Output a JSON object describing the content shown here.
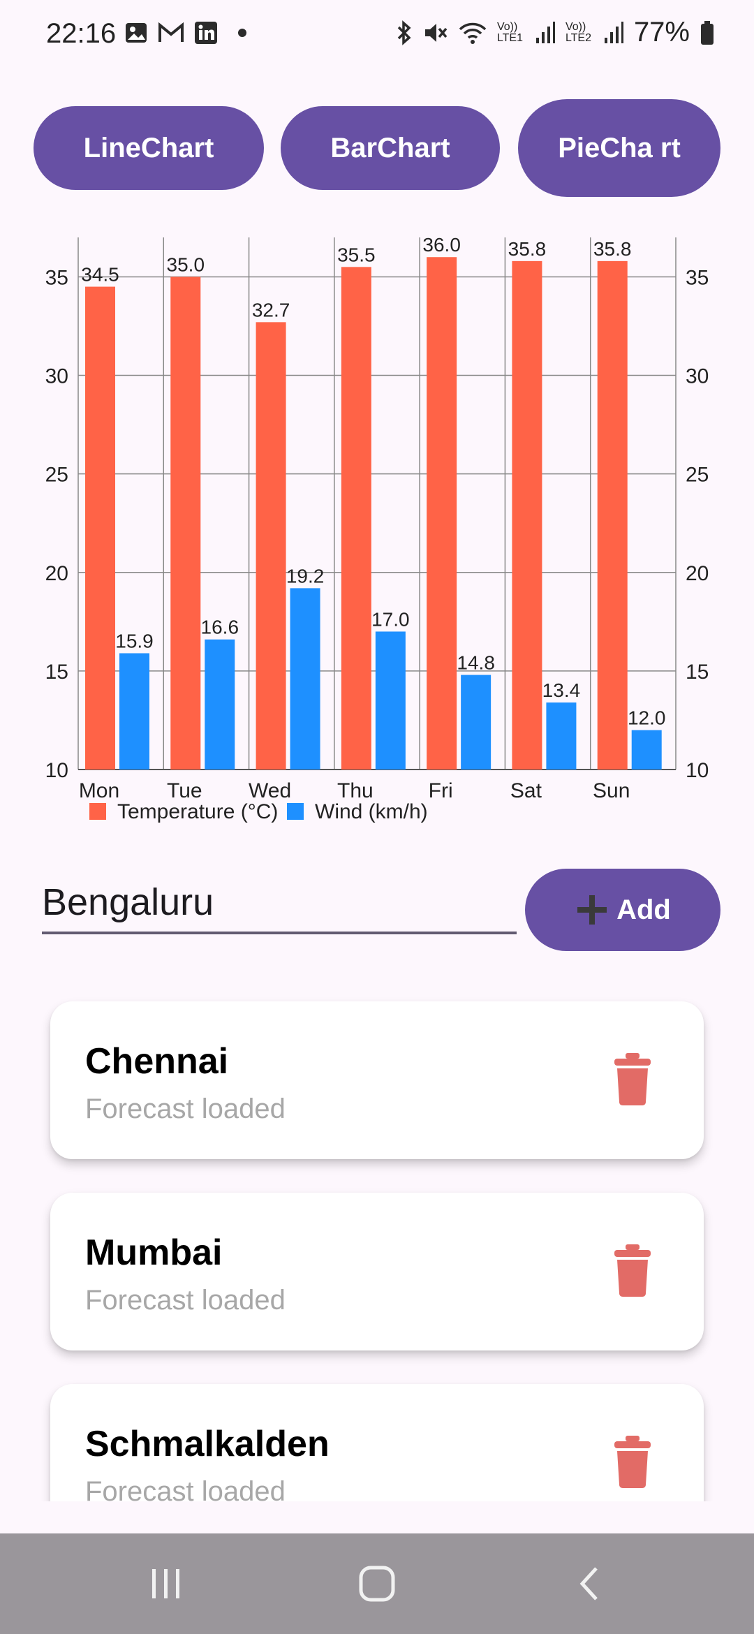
{
  "status_bar": {
    "time": "22:16",
    "battery": "77%",
    "sim1_label": "Vo)) LTE1",
    "sim2_label": "Vo)) LTE2",
    "icons": [
      "gallery-icon",
      "gmail-icon",
      "linkedin-icon",
      "dot-icon",
      "bluetooth-icon",
      "mute-icon",
      "wifi-icon",
      "signal-icon",
      "battery-icon"
    ]
  },
  "chart_buttons": [
    {
      "label": "LineChart"
    },
    {
      "label": "BarChart"
    },
    {
      "label": "PieCha rt"
    }
  ],
  "chart_data": {
    "type": "bar",
    "categories": [
      "Mon",
      "Tue",
      "Wed",
      "Thu",
      "Fri",
      "Sat",
      "Sun"
    ],
    "series": [
      {
        "name": "Temperature (°C)",
        "values": [
          34.5,
          35.0,
          32.7,
          35.5,
          36.0,
          35.8,
          35.8
        ],
        "color": "#ff6347"
      },
      {
        "name": "Wind (km/h)",
        "values": [
          15.9,
          16.6,
          19.2,
          17.0,
          14.8,
          13.4,
          12.0
        ],
        "color": "#1e90ff"
      }
    ],
    "ylim": [
      10,
      37
    ],
    "yticks": [
      10,
      15,
      20,
      25,
      30,
      35
    ],
    "grid": true,
    "legend": "bottom-left",
    "dual_axis_labels": true
  },
  "input": {
    "value": "Bengaluru"
  },
  "add_button": {
    "label": "Add",
    "icon": "plus-icon"
  },
  "cities": [
    {
      "name": "Chennai",
      "status": "Forecast loaded"
    },
    {
      "name": "Mumbai",
      "status": "Forecast loaded"
    },
    {
      "name": "Schmalkalden",
      "status": "Forecast loaded"
    }
  ],
  "colors": {
    "primary": "#6750a4",
    "background": "#fdf7fd",
    "delete": "#e26b66",
    "nav_bar": "#9a969b"
  },
  "nav": {
    "icons": [
      "recent-apps-icon",
      "home-icon",
      "back-icon"
    ]
  }
}
